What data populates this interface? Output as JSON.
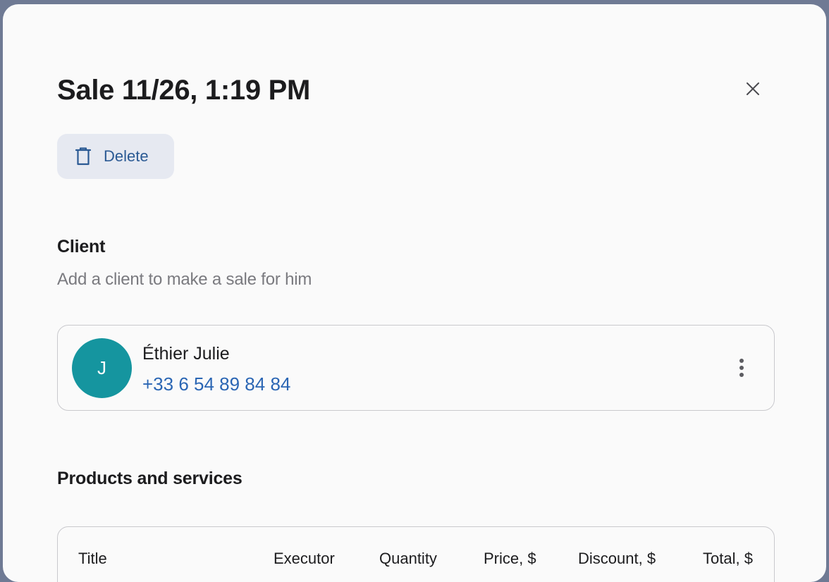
{
  "header": {
    "title": "Sale 11/26, 1:19 PM",
    "close_icon": "close-icon"
  },
  "actions": {
    "delete_label": "Delete",
    "delete_icon": "trash-icon",
    "accent_color": "#2b5a94"
  },
  "client": {
    "section_title": "Client",
    "subtitle": "Add a client to make a sale for him",
    "avatar_initial": "J",
    "avatar_color": "#15959f",
    "name": "Éthier Julie",
    "phone": "+33 6 54 89 84 84",
    "more_icon": "more-vertical-icon"
  },
  "products": {
    "section_title": "Products and services",
    "columns": [
      "Title",
      "Executor",
      "Quantity",
      "Price, $",
      "Discount, $",
      "Total, $"
    ]
  }
}
